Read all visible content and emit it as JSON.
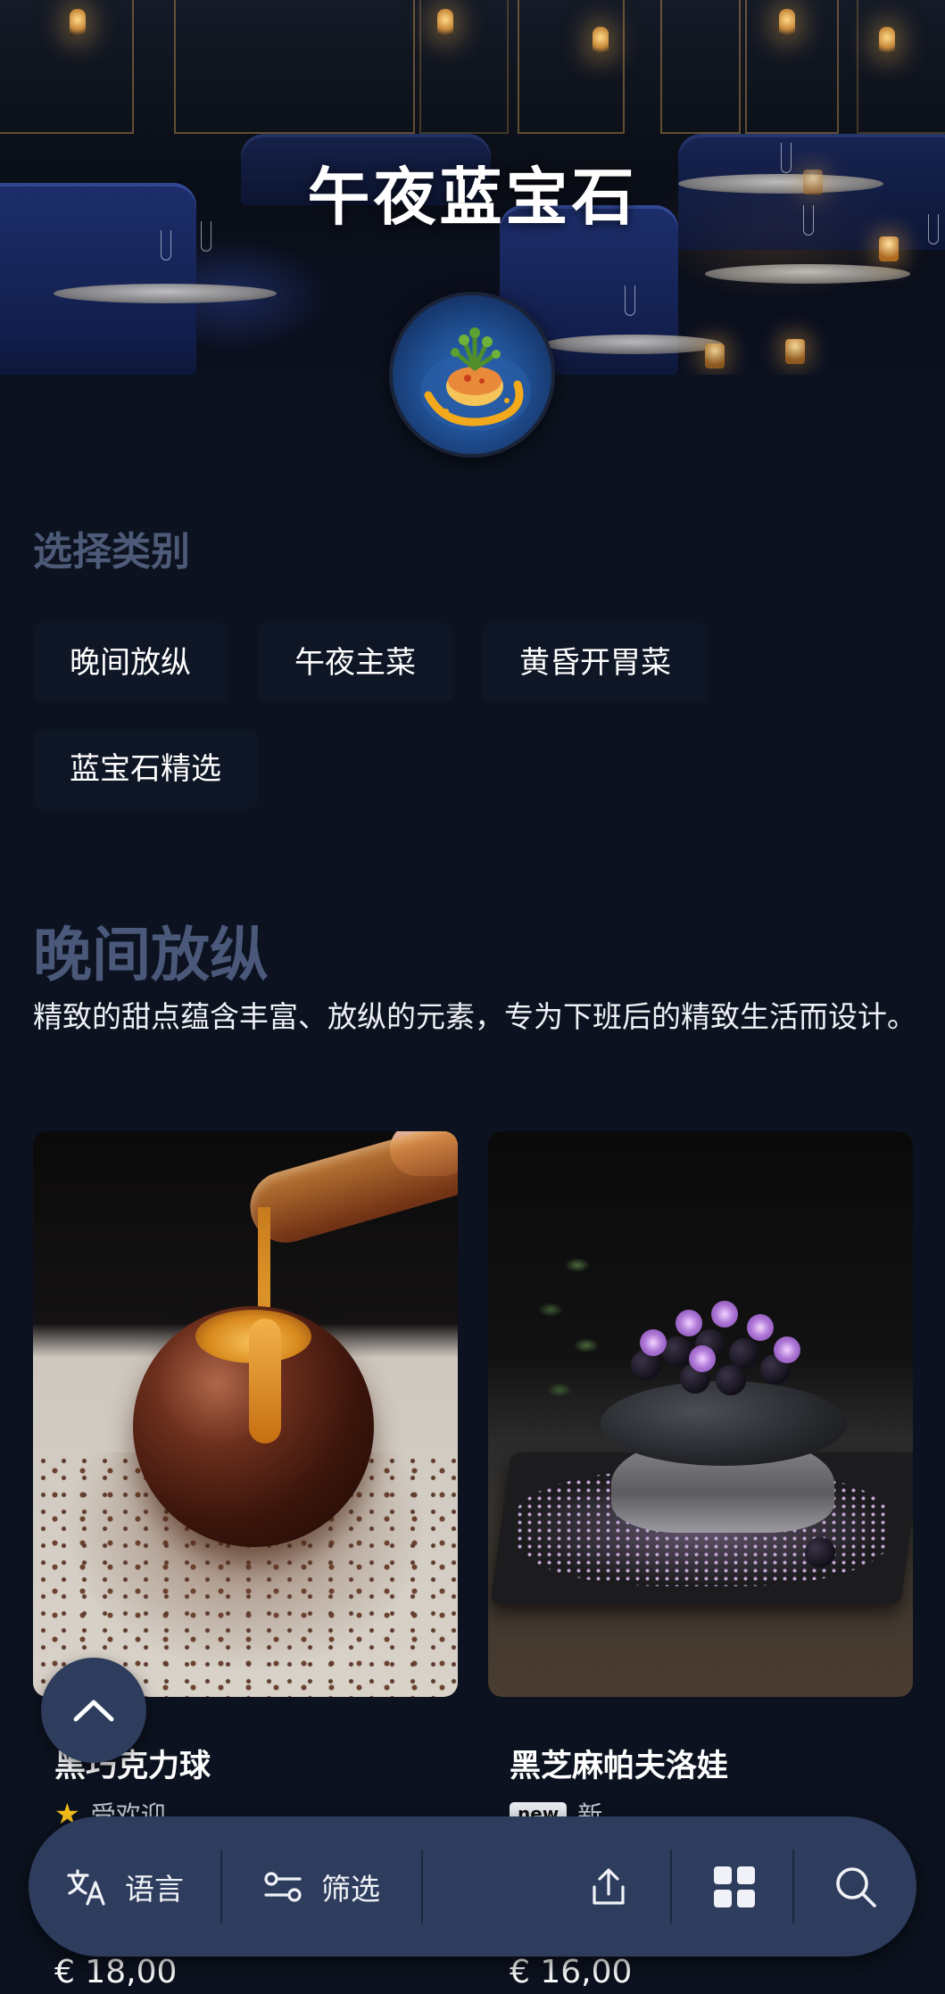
{
  "hero": {
    "title": "午夜蓝宝石"
  },
  "categories": {
    "label": "选择类别",
    "items": [
      {
        "label": "晚间放纵"
      },
      {
        "label": "午夜主菜"
      },
      {
        "label": "黄昏开胃菜"
      },
      {
        "label": "蓝宝石精选"
      }
    ]
  },
  "category": {
    "title": "晚间放纵",
    "description": "精致的甜点蕴含丰富、放纵的元素，专为下班后的精致生活而设计。"
  },
  "products": [
    {
      "name": "黑巧克力球",
      "tag": "受欢迎",
      "tag_icon": "star-icon",
      "price": "€ 18,00"
    },
    {
      "name": "黑芝麻帕夫洛娃",
      "badge": "new",
      "tag": "新",
      "price": "€ 16,00"
    }
  ],
  "bottom_bar": {
    "language_label": "语言",
    "filter_label": "筛选",
    "share_icon": "share-icon",
    "grid_icon": "grid-icon",
    "search_icon": "search-icon"
  },
  "colors": {
    "background": "#0c121f",
    "bar": "#2e3d5d",
    "accent_muted": "#4a587a",
    "star": "#f4c01b"
  }
}
